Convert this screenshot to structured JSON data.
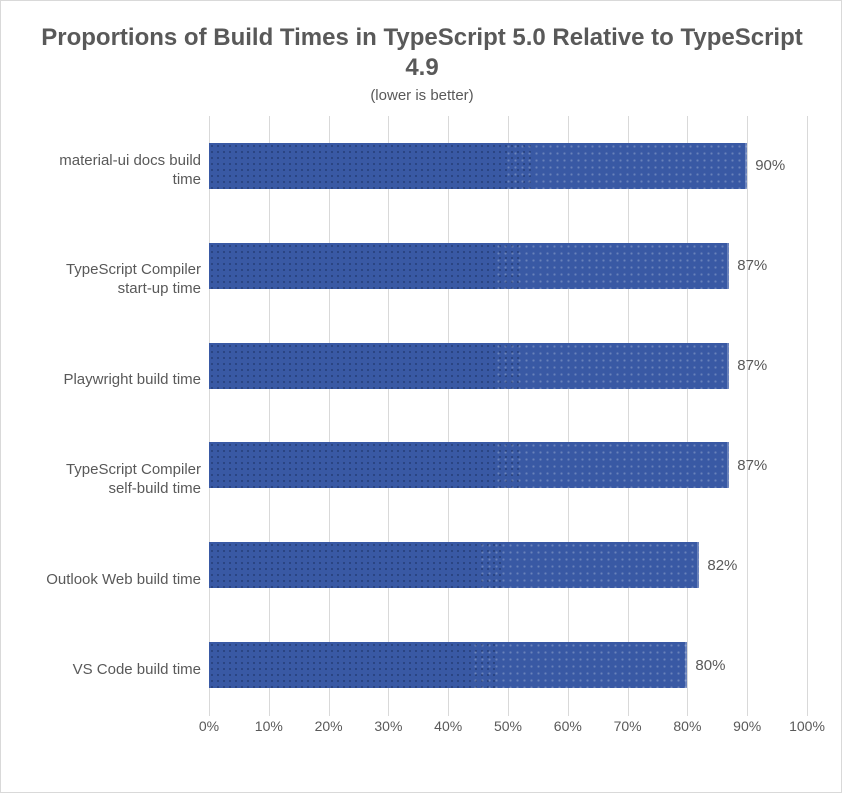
{
  "chart_data": {
    "type": "bar",
    "orientation": "horizontal",
    "title": "Proportions of Build Times in TypeScript 5.0 Relative to TypeScript 4.9",
    "subtitle": "(lower is better)",
    "xlabel": "",
    "ylabel": "",
    "xlim": [
      0,
      100
    ],
    "x_ticks": [
      0,
      10,
      20,
      30,
      40,
      50,
      60,
      70,
      80,
      90,
      100
    ],
    "x_tick_suffix": "%",
    "data_label_suffix": "%",
    "bar_color": "#3959a4",
    "categories": [
      "material-ui docs build time",
      "TypeScript Compiler start-up time",
      "Playwright build time",
      "TypeScript Compiler self-build time",
      "Outlook Web build time",
      "VS Code build time"
    ],
    "values": [
      90,
      87,
      87,
      87,
      82,
      80
    ]
  }
}
